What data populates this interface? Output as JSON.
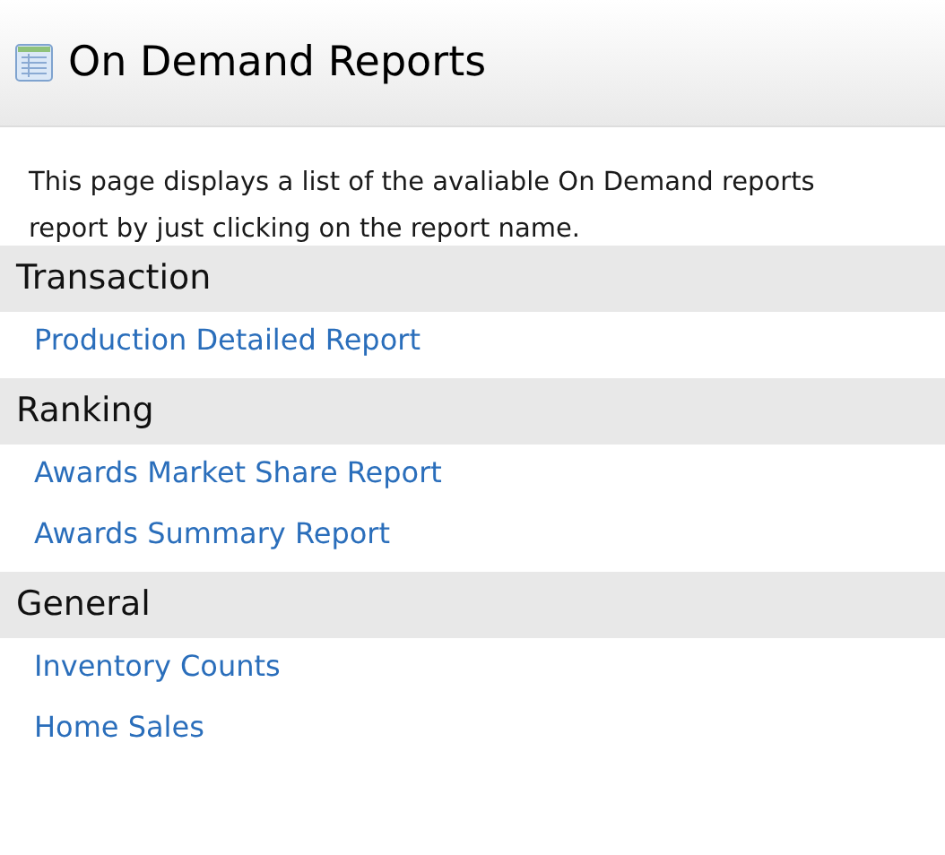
{
  "header": {
    "title": "On Demand Reports"
  },
  "description": [
    "This page displays a list of the avaliable On Demand reports",
    "report by just clicking on the report name."
  ],
  "sections": [
    {
      "title": "Transaction",
      "links": [
        "Production Detailed Report"
      ]
    },
    {
      "title": "Ranking",
      "links": [
        "Awards Market Share Report",
        "Awards Summary Report"
      ]
    },
    {
      "title": "General",
      "links": [
        "Inventory Counts",
        "Home Sales"
      ]
    }
  ]
}
